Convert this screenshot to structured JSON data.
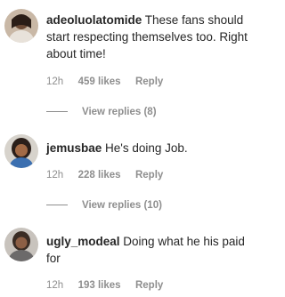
{
  "comments": [
    {
      "username": "adeoluolatomide",
      "text": "These fans should start respecting themselves too. Right about time!",
      "time": "12h",
      "likes": "459 likes",
      "reply": "Reply",
      "view_replies": "View replies (8)"
    },
    {
      "username": "jemusbae",
      "text": "He's doing Job.",
      "time": "12h",
      "likes": "228 likes",
      "reply": "Reply",
      "view_replies": "View replies (10)"
    },
    {
      "username": "ugly_modeal",
      "text": "Doing what he his paid for",
      "time": "12h",
      "likes": "193 likes",
      "reply": "Reply"
    }
  ]
}
